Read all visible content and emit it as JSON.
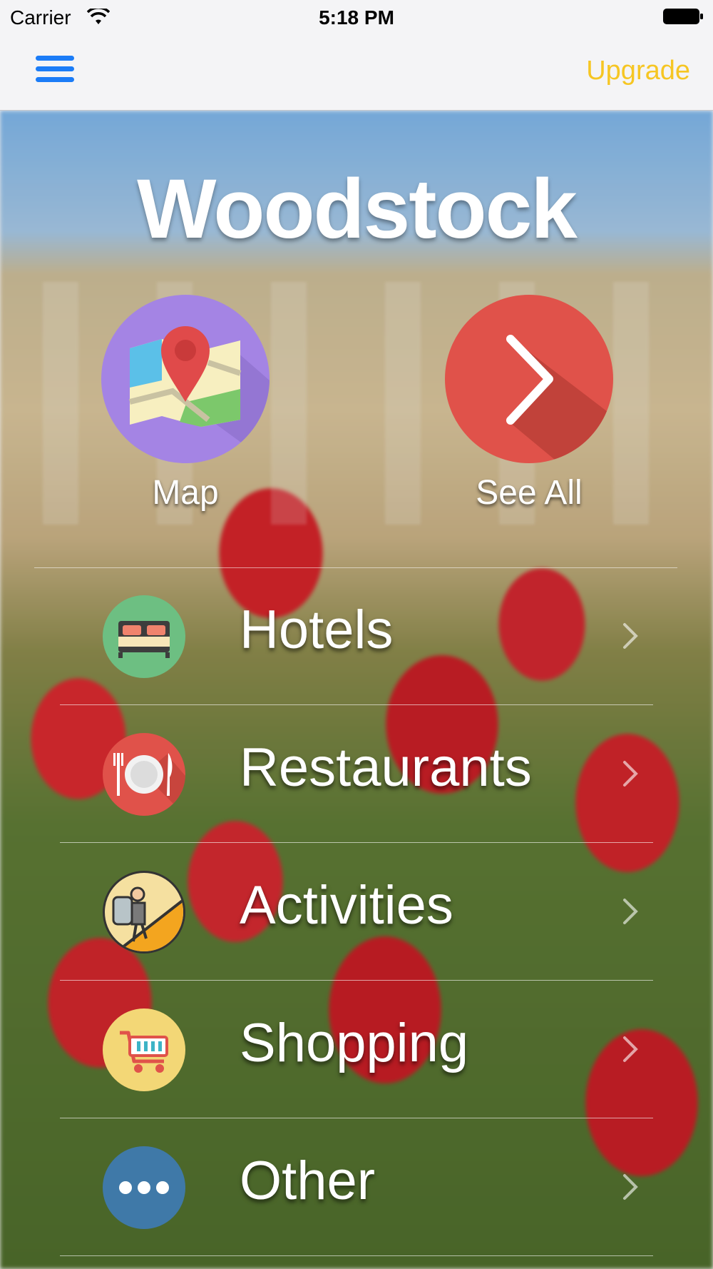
{
  "status_bar": {
    "carrier": "Carrier",
    "time": "5:18 PM"
  },
  "nav": {
    "upgrade_label": "Upgrade",
    "accent_color": "#1b7cf7",
    "upgrade_color": "#f6c623"
  },
  "hero": {
    "title": "Woodstock"
  },
  "quick_actions": [
    {
      "label": "Map",
      "icon": "map-pin-icon",
      "color": "#a484e4"
    },
    {
      "label": "See All",
      "icon": "chevron-right-icon",
      "color": "#e0524a"
    }
  ],
  "categories": [
    {
      "label": "Hotels",
      "icon": "bed-icon",
      "color": "#6dbf82"
    },
    {
      "label": "Restaurants",
      "icon": "plate-cutlery-icon",
      "color": "#e0524a"
    },
    {
      "label": "Activities",
      "icon": "hiker-icon",
      "color": "#f5e0a0"
    },
    {
      "label": "Shopping",
      "icon": "shopping-cart-icon",
      "color": "#f3d776"
    },
    {
      "label": "Other",
      "icon": "more-dots-icon",
      "color": "#3f79a8"
    }
  ]
}
